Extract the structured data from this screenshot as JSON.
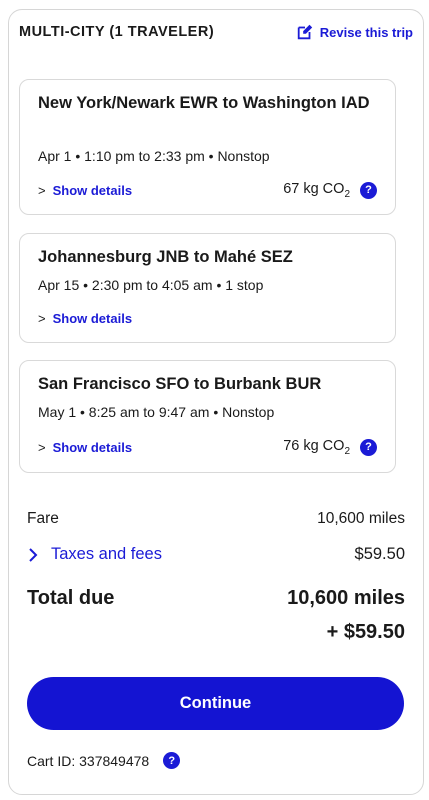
{
  "header": {
    "title": "MULTI-CITY (1 TRAVELER)",
    "revise_label": "Revise this trip"
  },
  "flights": [
    {
      "route": "New York/Newark EWR to Washington IAD",
      "times": "Apr 1 • 1:10 pm to 2:33 pm • Nonstop",
      "details_label": "Show details",
      "co2": "67 kg CO",
      "co2_sub": "2"
    },
    {
      "route": "Johannesburg JNB to Mahé SEZ",
      "times": "Apr 15 • 2:30 pm to 4:05 am • 1 stop",
      "details_label": "Show details"
    },
    {
      "route": "San Francisco SFO to Burbank BUR",
      "times": "May 1 • 8:25 am to 9:47 am • Nonstop",
      "details_label": "Show details",
      "co2": "76 kg CO",
      "co2_sub": "2"
    }
  ],
  "summary": {
    "fare_label": "Fare",
    "fare_value": "10,600 miles",
    "taxes_label": "Taxes and fees",
    "taxes_value": "$59.50",
    "total_label": "Total due",
    "total_miles": "10,600 miles",
    "total_usd": "+ $59.50"
  },
  "actions": {
    "continue_label": "Continue"
  },
  "cart": {
    "label": "Cart ID: 337849478"
  },
  "icons": {
    "help": "?",
    "chevron": ">"
  },
  "colors": {
    "accent": "#1414d2",
    "link": "#1b1bd6",
    "border": "#d9d9d9"
  }
}
